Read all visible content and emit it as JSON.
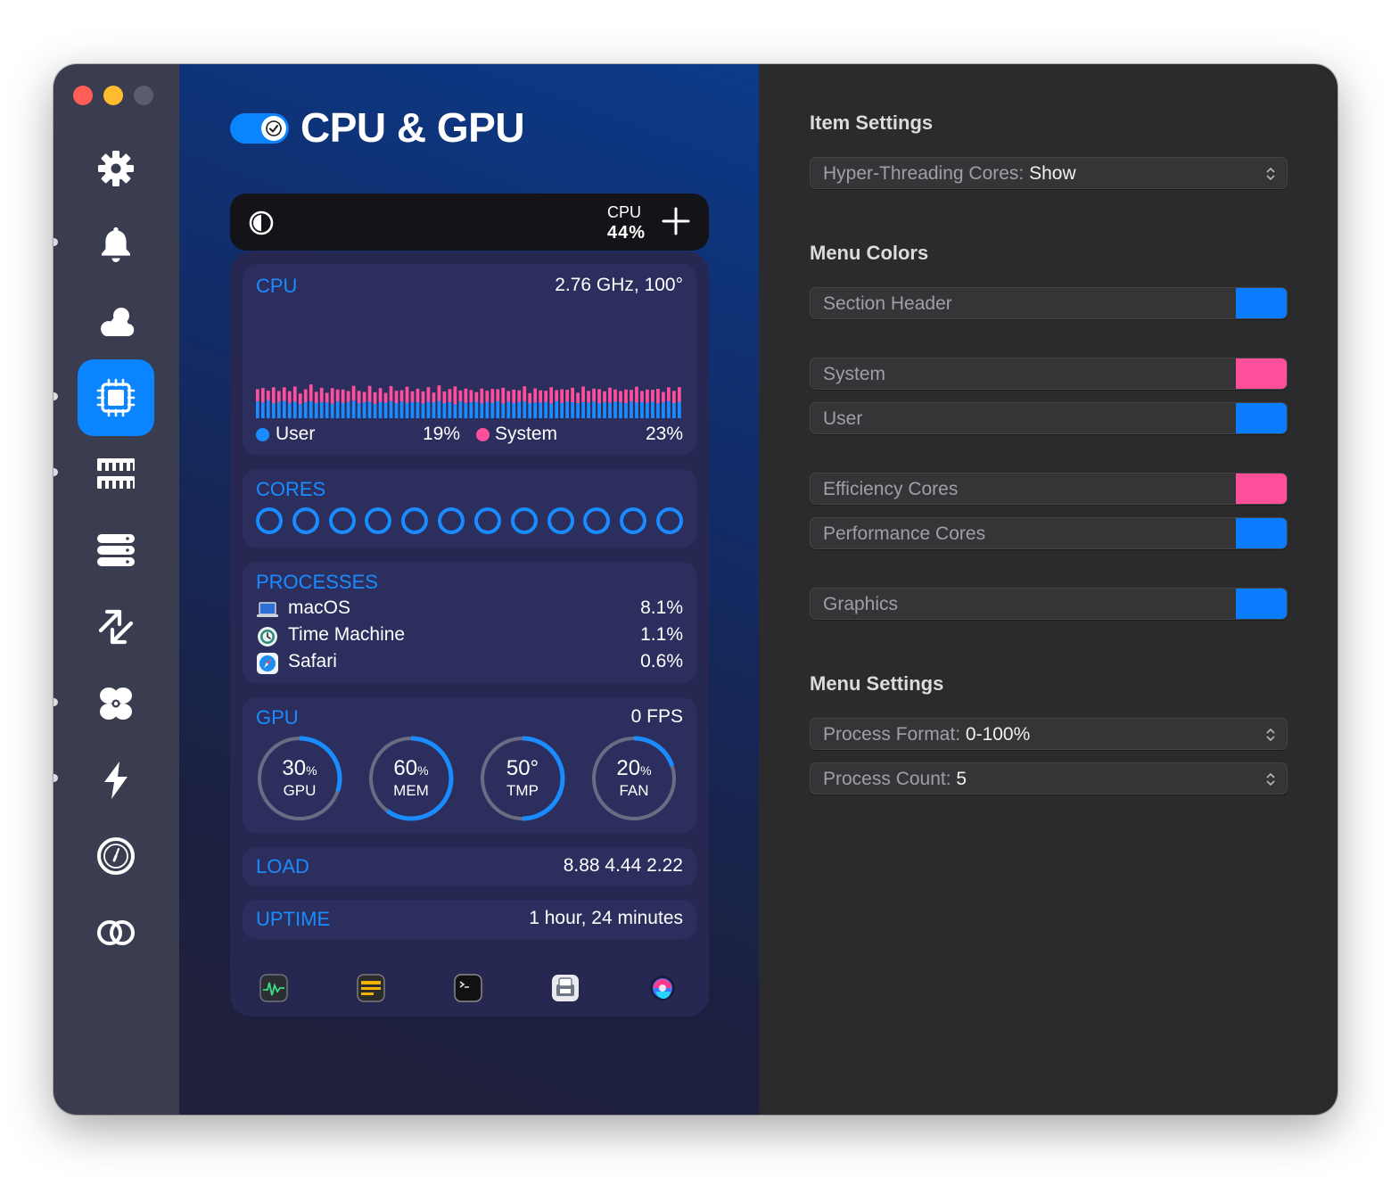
{
  "header": {
    "title": "CPU & GPU",
    "enabled": true
  },
  "sidebar": {
    "items": [
      {
        "icon": "gear-icon"
      },
      {
        "icon": "bell-icon"
      },
      {
        "icon": "cloud-sun-icon"
      },
      {
        "icon": "cpu-chip-icon",
        "active": true
      },
      {
        "icon": "memory-icon"
      },
      {
        "icon": "disk-stack-icon"
      },
      {
        "icon": "network-arrows-icon"
      },
      {
        "icon": "fan-icon"
      },
      {
        "icon": "bolt-icon"
      },
      {
        "icon": "clock-icon"
      },
      {
        "icon": "linked-rings-icon"
      }
    ]
  },
  "menubar": {
    "label": "CPU",
    "value": "44%"
  },
  "cpu": {
    "title": "CPU",
    "freq_temp": "2.76 GHz, 100°",
    "user_label": "User",
    "user_pct": "19%",
    "system_label": "System",
    "system_pct": "23%",
    "user_color": "#1a8cff",
    "system_color": "#ff4f9a",
    "history_user": [
      0.62,
      0.58,
      0.66,
      0.55,
      0.6,
      0.64,
      0.57,
      0.61,
      0.52,
      0.59,
      0.63,
      0.56,
      0.6,
      0.58,
      0.54,
      0.62,
      0.57,
      0.6,
      0.65,
      0.55,
      0.59,
      0.61,
      0.53,
      0.6,
      0.58,
      0.63,
      0.56,
      0.62,
      0.57,
      0.6,
      0.59,
      0.55,
      0.61,
      0.58,
      0.64,
      0.56,
      0.6,
      0.52,
      0.62,
      0.57,
      0.59,
      0.61,
      0.55,
      0.6,
      0.58,
      0.63,
      0.54,
      0.61,
      0.57,
      0.6,
      0.62,
      0.56,
      0.59,
      0.58,
      0.6,
      0.55,
      0.63,
      0.57,
      0.61,
      0.59,
      0.56,
      0.6,
      0.58,
      0.62,
      0.55,
      0.6,
      0.57,
      0.61,
      0.59,
      0.56,
      0.62,
      0.58,
      0.6,
      0.57,
      0.61,
      0.55,
      0.59,
      0.63,
      0.56,
      0.6
    ],
    "history_system": [
      0.38,
      0.45,
      0.3,
      0.5,
      0.34,
      0.42,
      0.36,
      0.47,
      0.33,
      0.4,
      0.52,
      0.35,
      0.44,
      0.3,
      0.48,
      0.37,
      0.41,
      0.34,
      0.46,
      0.39,
      0.32,
      0.49,
      0.36,
      0.43,
      0.3,
      0.47,
      0.38,
      0.35,
      0.5,
      0.33,
      0.42,
      0.37,
      0.45,
      0.31,
      0.48,
      0.36,
      0.4,
      0.55,
      0.34,
      0.44,
      0.38,
      0.3,
      0.46,
      0.35,
      0.42,
      0.37,
      0.49,
      0.33,
      0.41,
      0.36,
      0.47,
      0.31,
      0.43,
      0.38,
      0.35,
      0.5,
      0.34,
      0.42,
      0.37,
      0.45,
      0.32,
      0.48,
      0.36,
      0.4,
      0.44,
      0.33,
      0.47,
      0.38,
      0.35,
      0.42,
      0.36,
      0.49,
      0.34,
      0.41,
      0.37,
      0.45,
      0.32,
      0.43,
      0.38,
      0.46
    ]
  },
  "cores": {
    "title": "CORES",
    "count": 12
  },
  "processes": {
    "title": "PROCESSES",
    "items": [
      {
        "name": "macOS",
        "pct": "8.1%",
        "icon": "laptop-icon"
      },
      {
        "name": "Time Machine",
        "pct": "1.1%",
        "icon": "time-machine-icon"
      },
      {
        "name": "Safari",
        "pct": "0.6%",
        "icon": "safari-icon"
      }
    ]
  },
  "gpu": {
    "title": "GPU",
    "fps": "0 FPS",
    "gauges": [
      {
        "value": "30",
        "unit": "%",
        "label": "GPU",
        "fraction": 0.3
      },
      {
        "value": "60",
        "unit": "%",
        "label": "MEM",
        "fraction": 0.6
      },
      {
        "value": "50",
        "unit": "°",
        "label": "TMP",
        "fraction": 0.5
      },
      {
        "value": "20",
        "unit": "%",
        "label": "FAN",
        "fraction": 0.2
      }
    ]
  },
  "load": {
    "title": "LOAD",
    "value": "8.88 4.44 2.22"
  },
  "uptime": {
    "title": "UPTIME",
    "value": "1 hour, 24 minutes"
  },
  "dock": [
    "activity-monitor-icon",
    "console-icon",
    "terminal-icon",
    "system-information-icon",
    "siri-icon"
  ],
  "item_settings": {
    "title": "Item Settings",
    "hyper_threading": {
      "label": "Hyper-Threading Cores:",
      "value": "Show"
    }
  },
  "menu_colors": {
    "title": "Menu Colors",
    "section_header": {
      "label": "Section Header",
      "color": "#0a7cff"
    },
    "system": {
      "label": "System",
      "color": "#ff4f9a"
    },
    "user": {
      "label": "User",
      "color": "#0a7cff"
    },
    "efficiency": {
      "label": "Efficiency Cores",
      "color": "#ff4f9a"
    },
    "performance": {
      "label": "Performance Cores",
      "color": "#0a7cff"
    },
    "graphics": {
      "label": "Graphics",
      "color": "#0a7cff"
    }
  },
  "menu_settings": {
    "title": "Menu Settings",
    "process_format": {
      "label": "Process Format:",
      "value": "0-100%"
    },
    "process_count": {
      "label": "Process Count:",
      "value": "5"
    }
  }
}
